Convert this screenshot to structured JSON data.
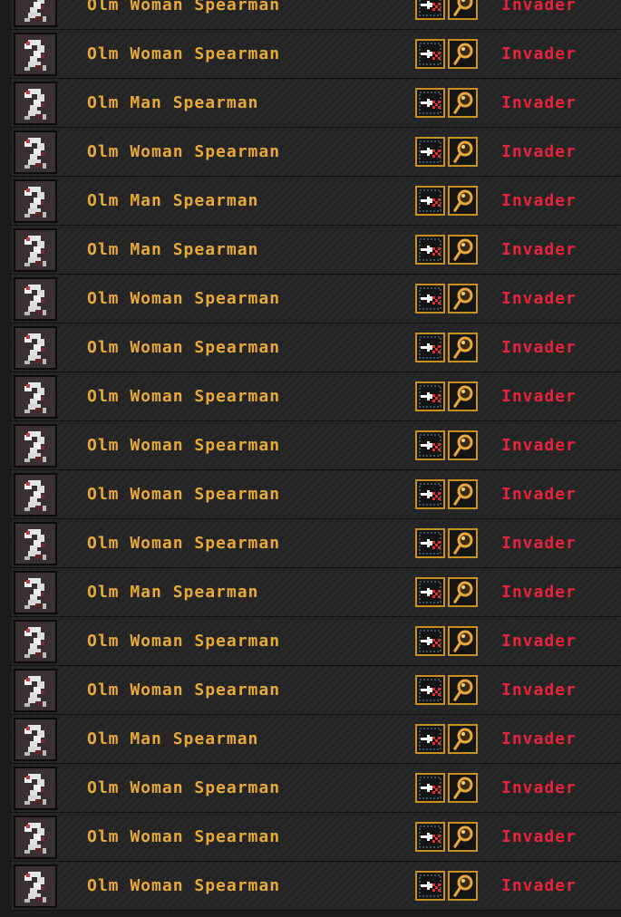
{
  "colors": {
    "name": "#e8a93a",
    "status_invader": "#e6243c",
    "button_border": "#c8901f",
    "background": "#1b1b1b"
  },
  "icons": {
    "portrait": "olm-creature-portrait-icon",
    "zoom_button": "zoom-to-unit-icon",
    "view_button": "magnifier-icon"
  },
  "units": [
    {
      "name": "Olm Woman Spearman",
      "status": "Invader"
    },
    {
      "name": "Olm Woman Spearman",
      "status": "Invader"
    },
    {
      "name": "Olm Man Spearman",
      "status": "Invader"
    },
    {
      "name": "Olm Woman Spearman",
      "status": "Invader"
    },
    {
      "name": "Olm Man Spearman",
      "status": "Invader"
    },
    {
      "name": "Olm Man Spearman",
      "status": "Invader"
    },
    {
      "name": "Olm Woman Spearman",
      "status": "Invader"
    },
    {
      "name": "Olm Woman Spearman",
      "status": "Invader"
    },
    {
      "name": "Olm Woman Spearman",
      "status": "Invader"
    },
    {
      "name": "Olm Woman Spearman",
      "status": "Invader"
    },
    {
      "name": "Olm Woman Spearman",
      "status": "Invader"
    },
    {
      "name": "Olm Woman Spearman",
      "status": "Invader"
    },
    {
      "name": "Olm Man Spearman",
      "status": "Invader"
    },
    {
      "name": "Olm Woman Spearman",
      "status": "Invader"
    },
    {
      "name": "Olm Woman Spearman",
      "status": "Invader"
    },
    {
      "name": "Olm Man Spearman",
      "status": "Invader"
    },
    {
      "name": "Olm Woman Spearman",
      "status": "Invader"
    },
    {
      "name": "Olm Woman Spearman",
      "status": "Invader"
    },
    {
      "name": "Olm Woman Spearman",
      "status": "Invader"
    }
  ]
}
